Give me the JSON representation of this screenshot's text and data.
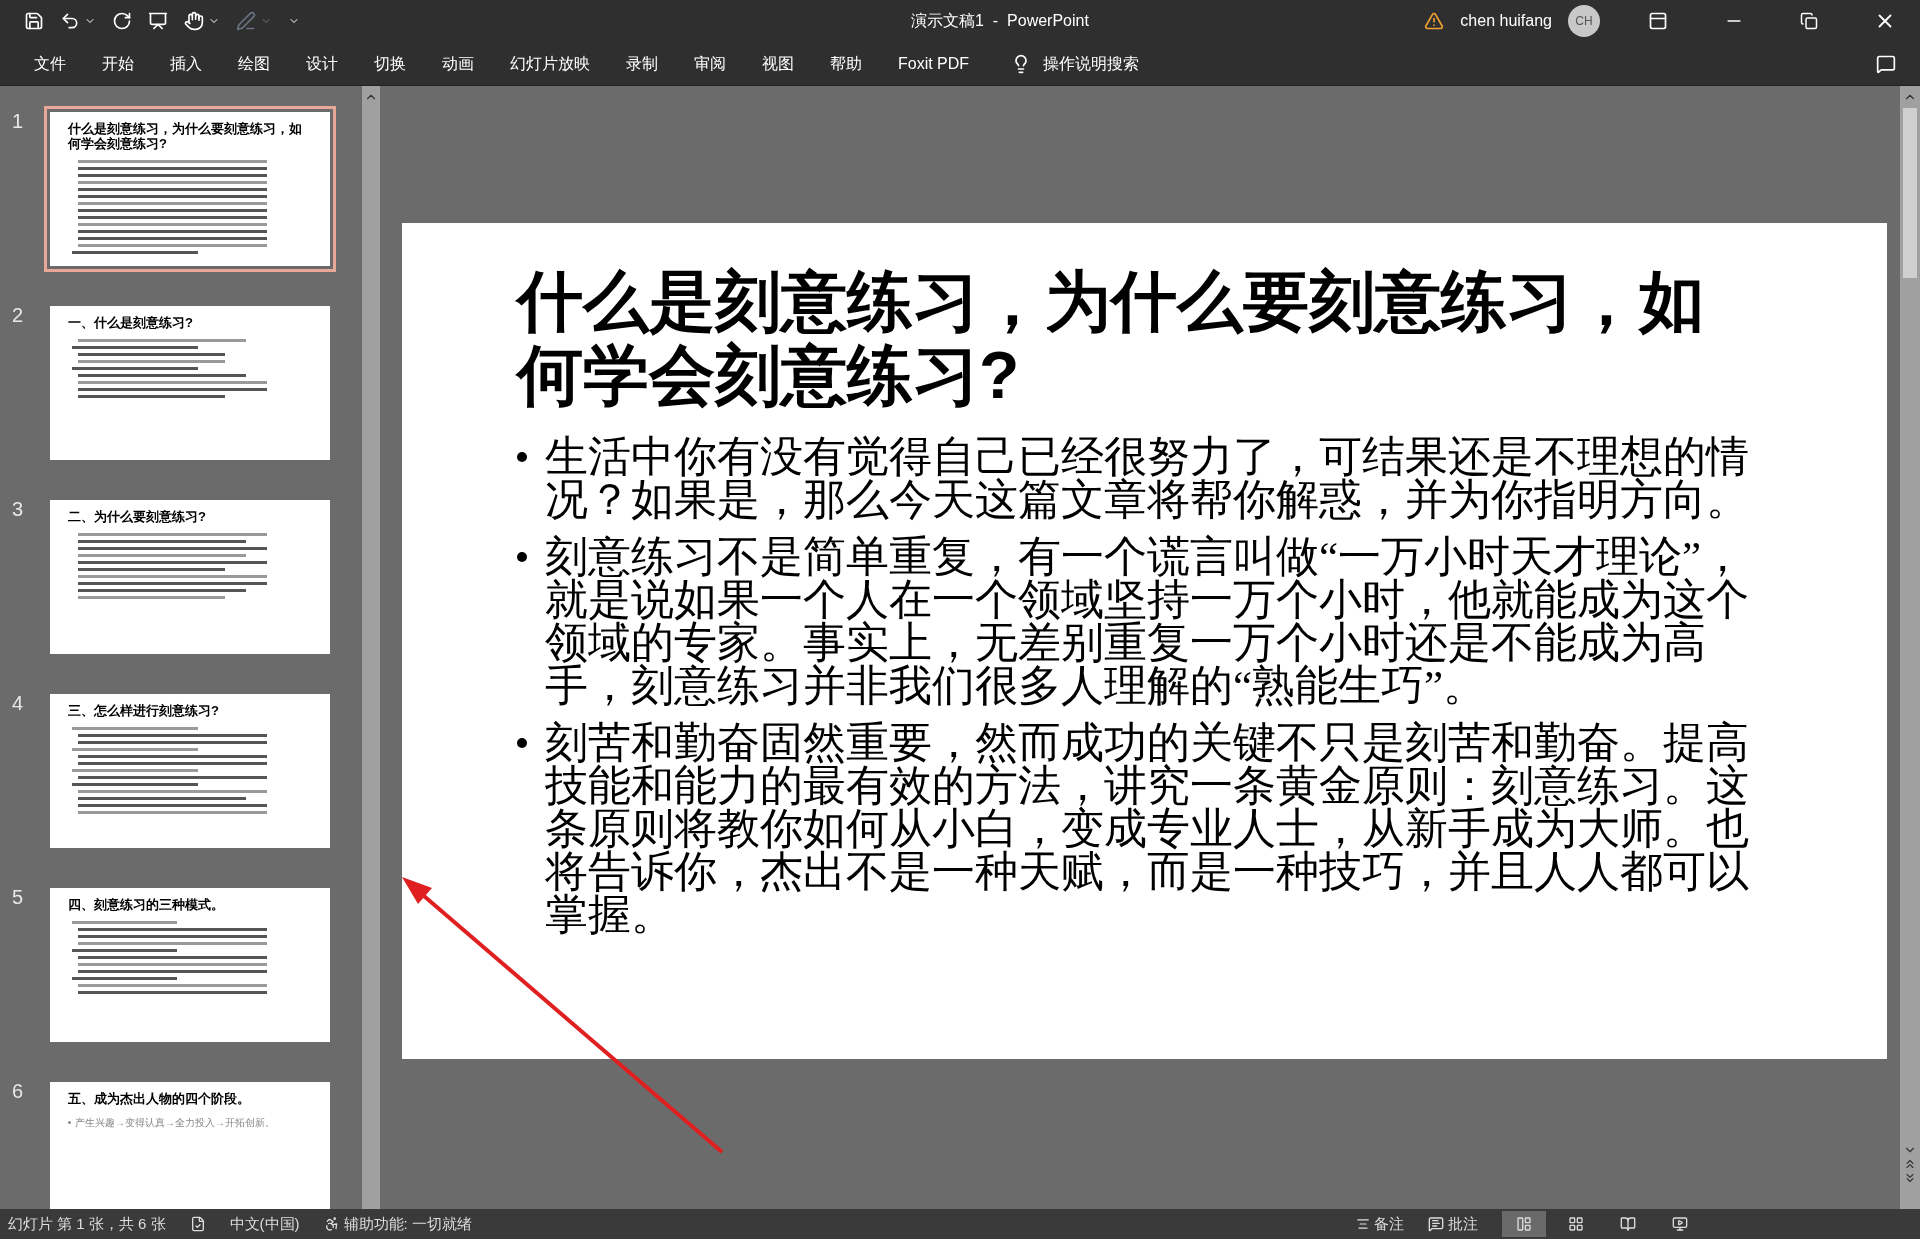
{
  "window": {
    "title": "演示文稿1  -  PowerPoint",
    "user": "chen huifang",
    "avatar_initials": "CH"
  },
  "ribbon_tabs": [
    {
      "label": "文件"
    },
    {
      "label": "开始"
    },
    {
      "label": "插入"
    },
    {
      "label": "绘图"
    },
    {
      "label": "设计"
    },
    {
      "label": "切换"
    },
    {
      "label": "动画"
    },
    {
      "label": "幻灯片放映"
    },
    {
      "label": "录制"
    },
    {
      "label": "审阅"
    },
    {
      "label": "视图"
    },
    {
      "label": "帮助"
    },
    {
      "label": "Foxit PDF"
    }
  ],
  "tell_me": "操作说明搜索",
  "thumbnails": [
    {
      "number": "1",
      "selected": true,
      "title": "什么是刻意练习，为什么要刻意练习，如何学会刻意练习?"
    },
    {
      "number": "2",
      "selected": false,
      "title": "一、什么是刻意练习?"
    },
    {
      "number": "3",
      "selected": false,
      "title": "二、为什么要刻意练习?"
    },
    {
      "number": "4",
      "selected": false,
      "title": "三、怎么样进行刻意练习?"
    },
    {
      "number": "5",
      "selected": false,
      "title": "四、刻意练习的三种模式。"
    },
    {
      "number": "6",
      "selected": false,
      "title": "五、成为杰出人物的四个阶段。",
      "body": "产生兴趣→变得认真→全力投入→开拓创新。"
    }
  ],
  "current_slide": {
    "title": "什么是刻意练习，为什么要刻意练习，如何学会刻意练习?",
    "bullets": [
      "生活中你有没有觉得自己已经很努力了，可结果还是不理想的情况？如果是，那么今天这篇文章将帮你解惑，并为你指明方向。",
      "刻意练习不是简单重复，有一个谎言叫做“一万小时天才理论”，就是说如果一个人在一个领域坚持一万个小时，他就能成为这个领域的专家。事实上，无差别重复一万个小时还是不能成为高手，刻意练习并非我们很多人理解的“熟能生巧”。",
      "刻苦和勤奋固然重要，然而成功的关键不只是刻苦和勤奋。提高技能和能力的最有效的方法，讲究一条黄金原则：刻意练习。这条原则将教你如何从小白，变成专业人士，从新手成为大师。也将告诉你，杰出不是一种天赋，而是一种技巧，并且人人都可以掌握。"
    ]
  },
  "status_bar": {
    "slide_info": "幻灯片 第 1 张，共 6 张",
    "language": "中文(中国)",
    "accessibility": "辅助功能: 一切就绪",
    "notes": "备注",
    "comments": "批注",
    "views": [
      {
        "kind": "normal",
        "selected": true
      },
      {
        "kind": "sorter",
        "selected": false
      },
      {
        "kind": "reading",
        "selected": false
      },
      {
        "kind": "slideshow",
        "selected": false
      }
    ]
  }
}
